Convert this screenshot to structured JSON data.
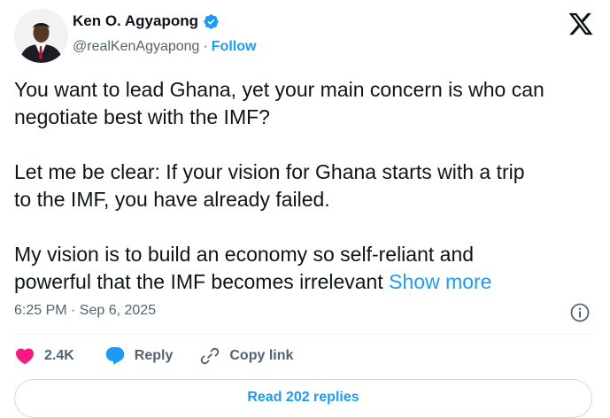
{
  "author": {
    "name": "Ken O. Agyapong",
    "handle": "@realKenAgyapong",
    "separator": "·",
    "follow_label": "Follow"
  },
  "tweet": {
    "text": "You want to lead Ghana, yet your main concern is who can\nnegotiate best with the IMF?\n\nLet me be clear: If your vision for Ghana starts with a trip\nto the IMF, you have already failed.\n\nMy vision is to build an economy so self-reliant and\npowerful that the IMF becomes irrelevant ",
    "show_more_label": "Show more",
    "timestamp": "6:25 PM · Sep 6, 2025"
  },
  "actions": {
    "likes": "2.4K",
    "reply_label": "Reply",
    "copy_link_label": "Copy link"
  },
  "replies_button": {
    "label": "Read 202 replies"
  },
  "colors": {
    "accent": "#1d9bf0",
    "like": "#f91880",
    "text": "#0f1419",
    "muted": "#536471"
  },
  "icons": [
    "verified-badge-icon",
    "x-logo-icon",
    "info-icon",
    "heart-icon",
    "reply-bubble-icon",
    "link-icon"
  ]
}
